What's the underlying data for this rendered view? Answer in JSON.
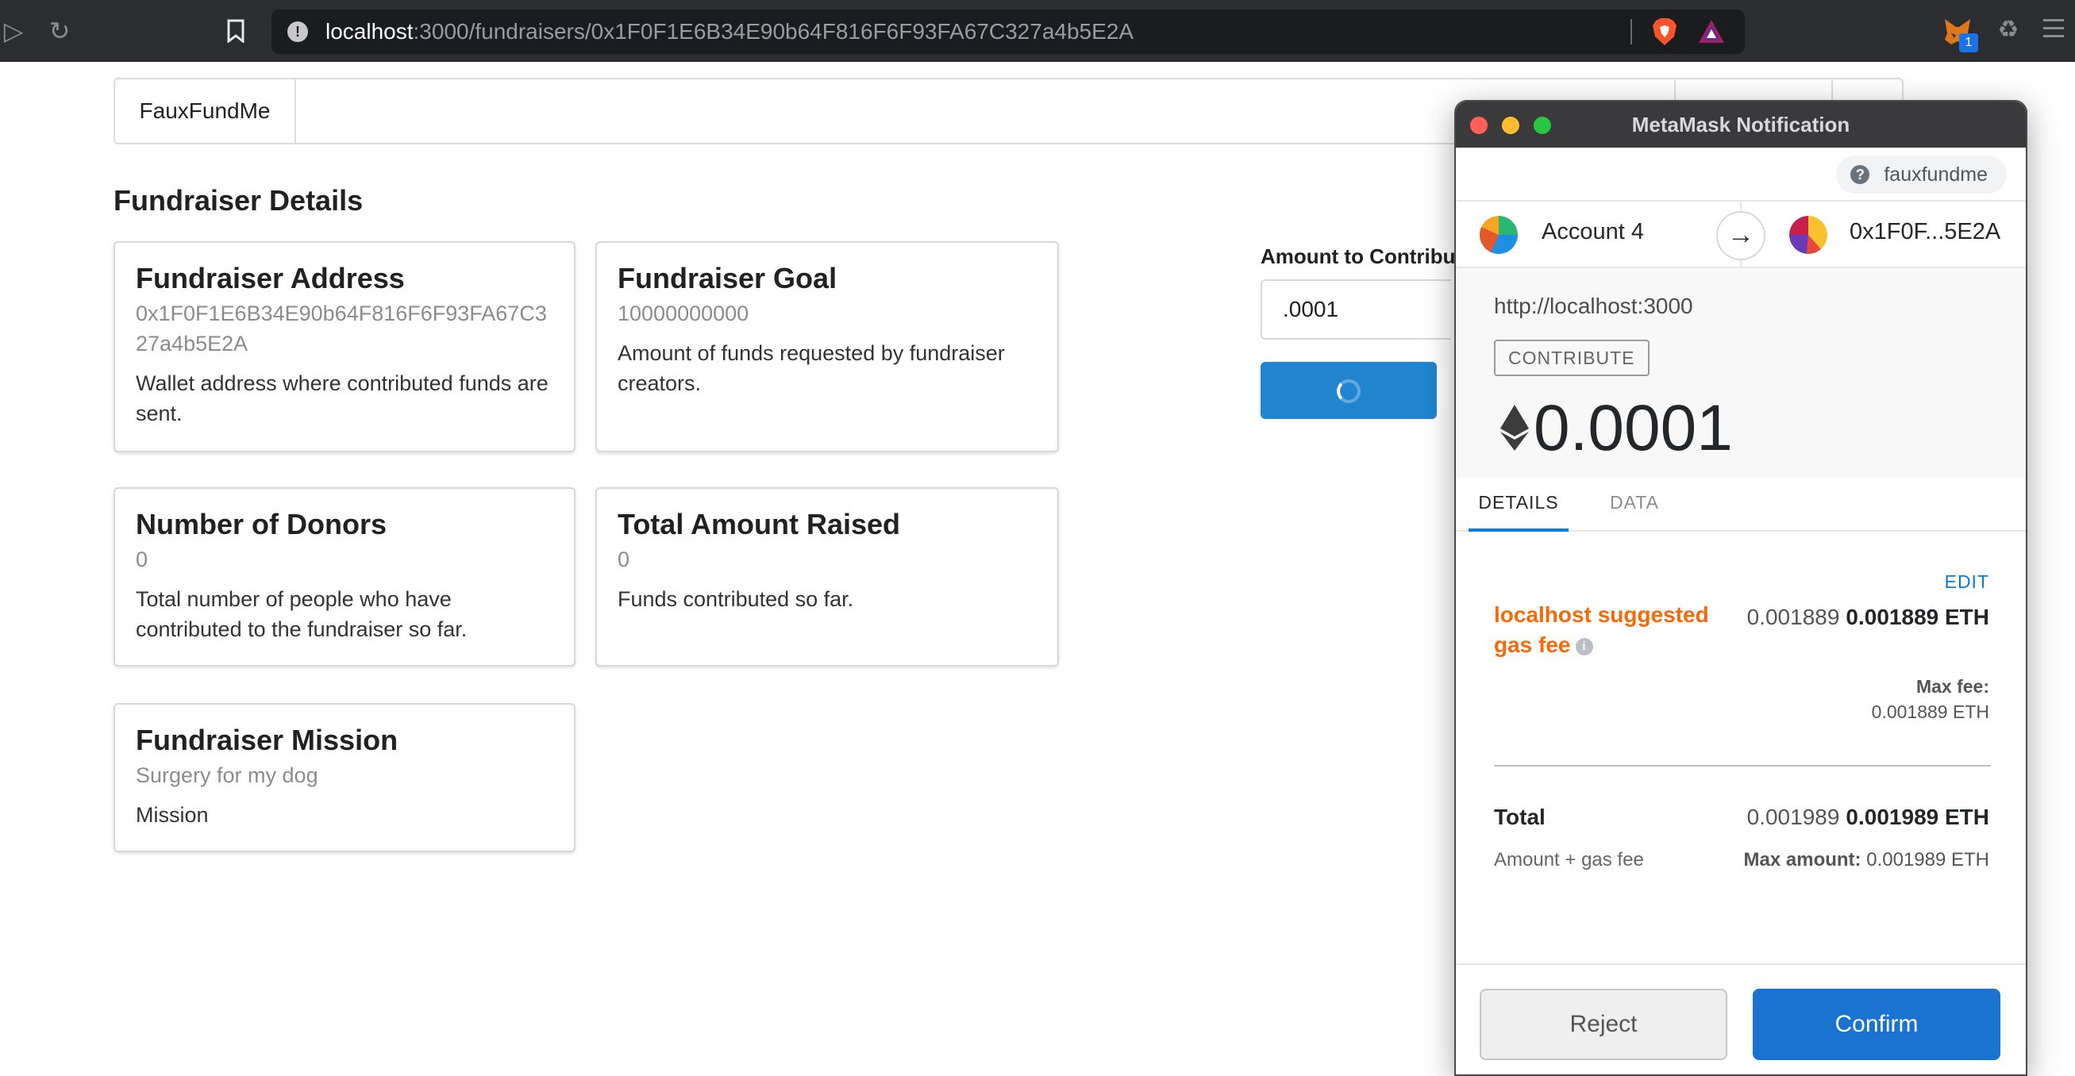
{
  "browser": {
    "url_host": "localhost",
    "url_path": ":3000/fundraisers/0x1F0F1E6B34E90b64F816F6F93FA67C327a4b5E2A",
    "extension_badge": "1"
  },
  "navbar": {
    "brand": "FauxFundMe"
  },
  "page": {
    "title": "Fundraiser Details"
  },
  "cards": {
    "address": {
      "title": "Fundraiser Address",
      "value": "0x1F0F1E6B34E90b64F816F6F93FA67C327a4b5E2A",
      "description": "Wallet address where contributed funds are sent."
    },
    "goal": {
      "title": "Fundraiser Goal",
      "value": "10000000000",
      "description": "Amount of funds requested by fundraiser creators."
    },
    "donors": {
      "title": "Number of Donors",
      "value": "0",
      "description": "Total number of people who have contributed to the fundraiser so far."
    },
    "raised": {
      "title": "Total Amount Raised",
      "value": "0",
      "description": "Funds contributed so far."
    },
    "mission": {
      "title": "Fundraiser Mission",
      "value": "Surgery for my dog",
      "description": "Mission"
    }
  },
  "contribute": {
    "label": "Amount to Contribut",
    "input_value": ".0001"
  },
  "metamask": {
    "window_title": "MetaMask Notification",
    "origin": "fauxfundme",
    "from_account": "Account 4",
    "to_account": "0x1F0F...5E2A",
    "site_origin": "http://localhost:3000",
    "method": "CONTRIBUTE",
    "amount": "0.0001",
    "tabs": [
      "DETAILS",
      "DATA"
    ],
    "edit_label": "EDIT",
    "gas_label": "localhost suggested gas fee",
    "gas_fee_secondary": "0.001889",
    "gas_fee_primary": "0.001889 ETH",
    "max_fee_label": "Max fee:",
    "max_fee_value": "0.001889 ETH",
    "total_label": "Total",
    "total_secondary": "0.001989",
    "total_primary": "0.001989 ETH",
    "total_sub_label": "Amount + gas fee",
    "max_amount_label": "Max amount:",
    "max_amount_value": "0.001989 ETH",
    "reject_label": "Reject",
    "confirm_label": "Confirm"
  },
  "colors": {
    "primary_button": "#2185d0",
    "metamask_blue": "#037dd6",
    "gas_label_orange": "#f66a0a",
    "chrome_dark": "#2c2d31"
  }
}
